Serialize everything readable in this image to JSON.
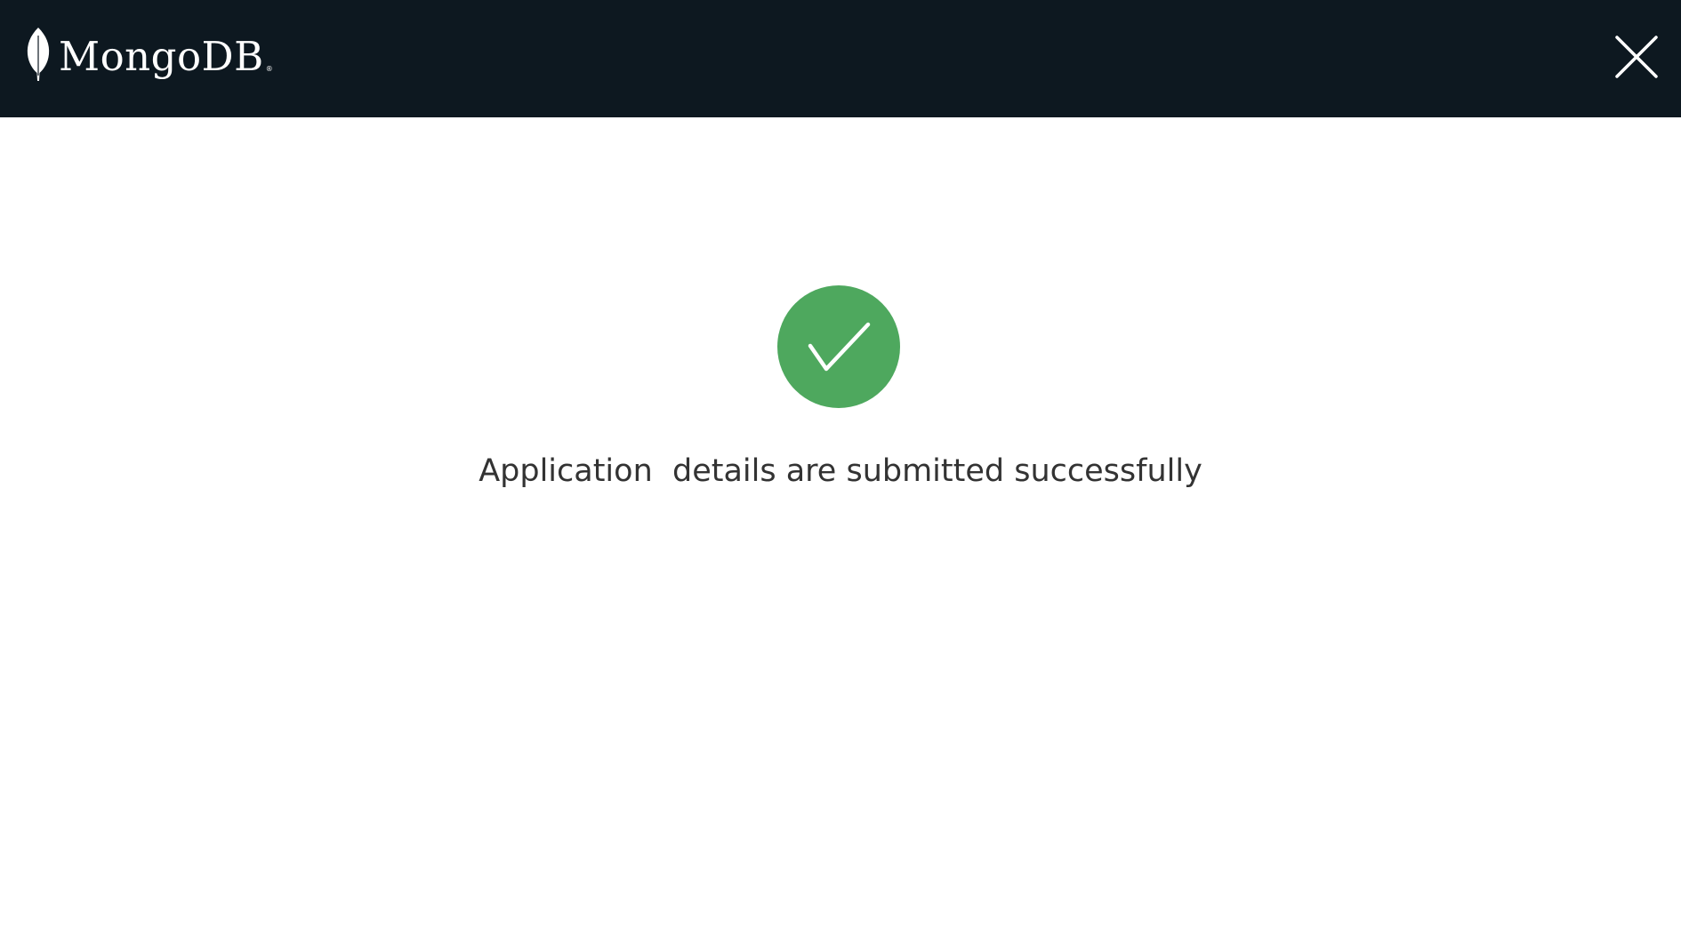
{
  "header": {
    "brand_name": "MongoDB",
    "brand_mark": "®",
    "brand_icon": "leaf-icon",
    "close_icon": "close-icon",
    "background_color": "#0d1820"
  },
  "main": {
    "status_icon": "check-circle-icon",
    "status_color": "#4ea85e",
    "message": "Application  details are submitted successfully"
  }
}
